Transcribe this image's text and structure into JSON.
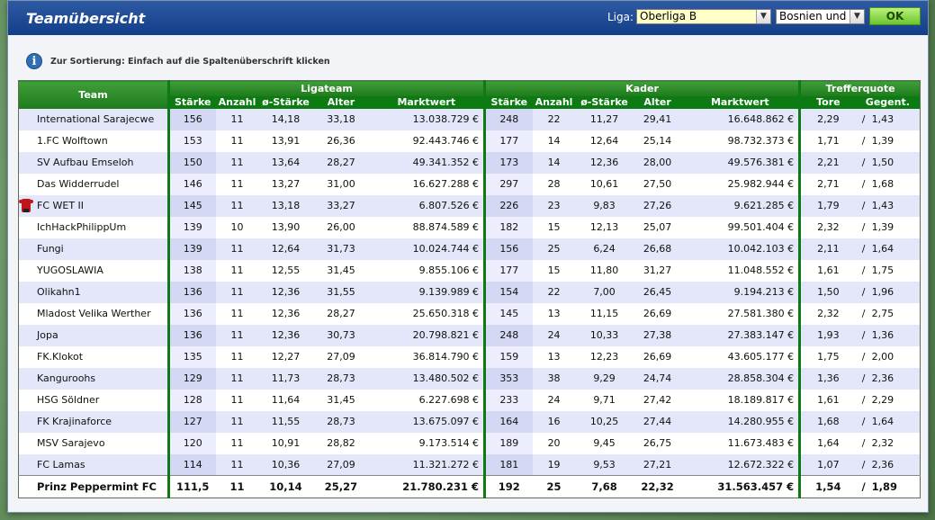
{
  "window": {
    "title": "Teamübersicht",
    "liga_label": "Liga:",
    "liga_select": "Oberliga B",
    "country_select": "Bosnien und",
    "ok_label": "OK",
    "hint": "Zur Sortierung: Einfach auf die Spaltenüberschrift klicken"
  },
  "table": {
    "team_header": "Team",
    "groups": {
      "liga": "Ligateam",
      "kader": "Kader",
      "quote": "Trefferquote"
    },
    "columns": {
      "liga": [
        "Stärke",
        "Anzahl",
        "ø-Stärke",
        "Alter",
        "Marktwert"
      ],
      "kader": [
        "Stärke",
        "Anzahl",
        "ø-Stärke",
        "Alter",
        "Marktwert"
      ],
      "quote": [
        "Tore",
        "Gegent."
      ]
    },
    "separator": "/",
    "rows": [
      {
        "team": "International Sarajecwe",
        "l": [
          "156",
          "11",
          "14,18",
          "33,18",
          "13.038.729 €"
        ],
        "k": [
          "248",
          "22",
          "11,27",
          "29,41",
          "16.648.862 €"
        ],
        "q": [
          "2,29",
          "1,43"
        ]
      },
      {
        "team": "1.FC Wolftown",
        "l": [
          "153",
          "11",
          "13,91",
          "26,36",
          "92.443.746 €"
        ],
        "k": [
          "177",
          "14",
          "12,64",
          "25,14",
          "98.732.373 €"
        ],
        "q": [
          "1,71",
          "1,39"
        ]
      },
      {
        "team": "SV Aufbau Emseloh",
        "l": [
          "150",
          "11",
          "13,64",
          "28,27",
          "49.341.352 €"
        ],
        "k": [
          "173",
          "14",
          "12,36",
          "28,00",
          "49.576.381 €"
        ],
        "q": [
          "2,21",
          "1,50"
        ]
      },
      {
        "team": "Das Widderrudel",
        "l": [
          "146",
          "11",
          "13,27",
          "31,00",
          "16.627.288 €"
        ],
        "k": [
          "297",
          "28",
          "10,61",
          "27,50",
          "25.982.944 €"
        ],
        "q": [
          "2,71",
          "1,68"
        ]
      },
      {
        "team": "FC WET II",
        "own": true,
        "l": [
          "145",
          "11",
          "13,18",
          "33,27",
          "6.807.526 €"
        ],
        "k": [
          "226",
          "23",
          "9,83",
          "27,26",
          "9.621.285 €"
        ],
        "q": [
          "1,79",
          "1,43"
        ]
      },
      {
        "team": "IchHackPhilippUm",
        "l": [
          "139",
          "10",
          "13,90",
          "26,00",
          "88.874.589 €"
        ],
        "k": [
          "182",
          "15",
          "12,13",
          "25,07",
          "99.501.404 €"
        ],
        "q": [
          "2,32",
          "1,39"
        ]
      },
      {
        "team": "Fungi",
        "l": [
          "139",
          "11",
          "12,64",
          "31,73",
          "10.024.744 €"
        ],
        "k": [
          "156",
          "25",
          "6,24",
          "26,68",
          "10.042.103 €"
        ],
        "q": [
          "2,11",
          "1,64"
        ]
      },
      {
        "team": "YUGOSLAWIA",
        "l": [
          "138",
          "11",
          "12,55",
          "31,45",
          "9.855.106 €"
        ],
        "k": [
          "177",
          "15",
          "11,80",
          "31,27",
          "11.048.552 €"
        ],
        "q": [
          "1,61",
          "1,75"
        ]
      },
      {
        "team": "Olikahn1",
        "l": [
          "136",
          "11",
          "12,36",
          "31,55",
          "9.139.989 €"
        ],
        "k": [
          "154",
          "22",
          "7,00",
          "26,45",
          "9.194.213 €"
        ],
        "q": [
          "1,50",
          "1,96"
        ]
      },
      {
        "team": "Mladost Velika Werther",
        "l": [
          "136",
          "11",
          "12,36",
          "28,27",
          "25.650.318 €"
        ],
        "k": [
          "145",
          "13",
          "11,15",
          "26,69",
          "27.581.380 €"
        ],
        "q": [
          "2,32",
          "2,75"
        ]
      },
      {
        "team": "Jopa",
        "l": [
          "136",
          "11",
          "12,36",
          "30,73",
          "20.798.821 €"
        ],
        "k": [
          "248",
          "24",
          "10,33",
          "27,38",
          "27.383.147 €"
        ],
        "q": [
          "1,93",
          "1,36"
        ]
      },
      {
        "team": "FK.Klokot",
        "l": [
          "135",
          "11",
          "12,27",
          "27,09",
          "36.814.790 €"
        ],
        "k": [
          "159",
          "13",
          "12,23",
          "26,69",
          "43.605.177 €"
        ],
        "q": [
          "1,75",
          "2,00"
        ]
      },
      {
        "team": "Kanguroohs",
        "l": [
          "129",
          "11",
          "11,73",
          "28,73",
          "13.480.502 €"
        ],
        "k": [
          "353",
          "38",
          "9,29",
          "24,74",
          "28.858.304 €"
        ],
        "q": [
          "1,36",
          "2,36"
        ]
      },
      {
        "team": "HSG Söldner",
        "l": [
          "128",
          "11",
          "11,64",
          "31,45",
          "6.227.698 €"
        ],
        "k": [
          "233",
          "24",
          "9,71",
          "27,42",
          "18.189.817 €"
        ],
        "q": [
          "1,61",
          "2,29"
        ]
      },
      {
        "team": "FK Krajinaforce",
        "l": [
          "127",
          "11",
          "11,55",
          "28,73",
          "13.675.097 €"
        ],
        "k": [
          "164",
          "16",
          "10,25",
          "27,44",
          "14.280.955 €"
        ],
        "q": [
          "1,68",
          "1,64"
        ]
      },
      {
        "team": "MSV Sarajevo",
        "l": [
          "120",
          "11",
          "10,91",
          "28,82",
          "9.173.514 €"
        ],
        "k": [
          "189",
          "20",
          "9,45",
          "26,75",
          "11.673.483 €"
        ],
        "q": [
          "1,64",
          "2,32"
        ]
      },
      {
        "team": "FC Lamas",
        "l": [
          "114",
          "11",
          "10,36",
          "27,09",
          "11.321.272 €"
        ],
        "k": [
          "181",
          "19",
          "9,53",
          "27,21",
          "12.672.322 €"
        ],
        "q": [
          "1,07",
          "2,36"
        ]
      }
    ],
    "total": {
      "team": "Prinz Peppermint FC",
      "l": [
        "111,5",
        "11",
        "10,14",
        "25,27",
        "21.780.231 €"
      ],
      "k": [
        "192",
        "25",
        "7,68",
        "22,32",
        "31.563.457 €"
      ],
      "q": [
        "1,54",
        "1,89"
      ]
    }
  }
}
